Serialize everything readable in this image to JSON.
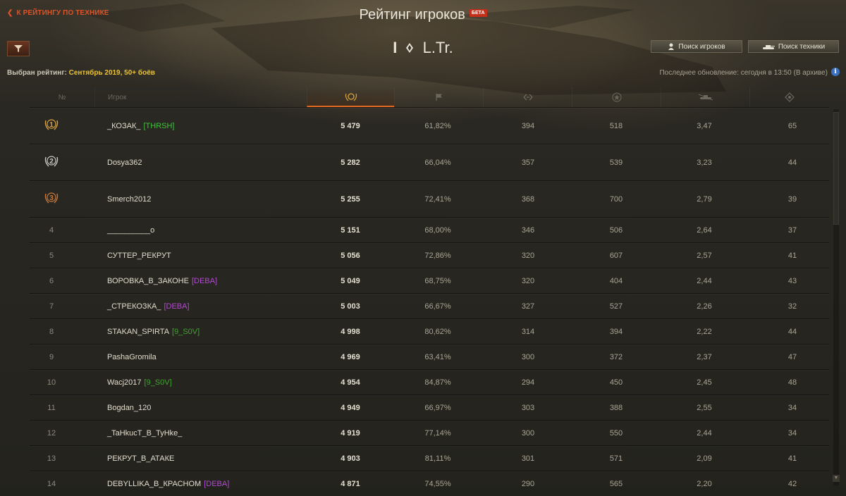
{
  "header": {
    "back_label": "К РЕЙТИНГУ ПО ТЕХНИКЕ",
    "title": "Рейтинг игроков",
    "beta": "БЕТА",
    "vehicle_tier": "I",
    "vehicle_name": "L.Tr.",
    "search_players_label": "Поиск игроков",
    "search_vehicles_label": "Поиск техники",
    "selected_rating_label": "Выбран рейтинг:",
    "selected_rating_value": "Сентябрь 2019, 50+ боёв",
    "last_update": "Последнее обновление: сегодня в 13:50 (В архиве)",
    "info_glyph": "i"
  },
  "table": {
    "col_rank": "№",
    "col_player": "Игрок",
    "rows": [
      {
        "rank": "1",
        "name": "_КОЗАК_",
        "clan": "[THRSH]",
        "clan_color": "#3fc43a",
        "rating": "5 479",
        "win": "61,82%",
        "dmg": "394",
        "exp": "518",
        "frags": "3,47",
        "spot": "65"
      },
      {
        "rank": "2",
        "name": "Dosya362",
        "clan": "",
        "clan_color": "",
        "rating": "5 282",
        "win": "66,04%",
        "dmg": "357",
        "exp": "539",
        "frags": "3,23",
        "spot": "44"
      },
      {
        "rank": "3",
        "name": "Smerch2012",
        "clan": "",
        "clan_color": "",
        "rating": "5 255",
        "win": "72,41%",
        "dmg": "368",
        "exp": "700",
        "frags": "2,79",
        "spot": "39"
      },
      {
        "rank": "4",
        "name": "__________o",
        "clan": "",
        "clan_color": "",
        "rating": "5 151",
        "win": "68,00%",
        "dmg": "346",
        "exp": "506",
        "frags": "2,64",
        "spot": "37"
      },
      {
        "rank": "5",
        "name": "СУТТЕР_РЕКРУТ",
        "clan": "",
        "clan_color": "",
        "rating": "5 056",
        "win": "72,86%",
        "dmg": "320",
        "exp": "607",
        "frags": "2,57",
        "spot": "41"
      },
      {
        "rank": "6",
        "name": "ВОРОВКА_В_ЗАКОНЕ",
        "clan": "[DEBA]",
        "clan_color": "#b14ad1",
        "rating": "5 049",
        "win": "68,75%",
        "dmg": "320",
        "exp": "404",
        "frags": "2,44",
        "spot": "43"
      },
      {
        "rank": "7",
        "name": "_СТРЕКОЗКА_",
        "clan": "[DEBA]",
        "clan_color": "#b14ad1",
        "rating": "5 003",
        "win": "66,67%",
        "dmg": "327",
        "exp": "527",
        "frags": "2,26",
        "spot": "32"
      },
      {
        "rank": "8",
        "name": "STAKAN_SPIRTA",
        "clan": "[9_S0V]",
        "clan_color": "#3ea52f",
        "rating": "4 998",
        "win": "80,62%",
        "dmg": "314",
        "exp": "394",
        "frags": "2,22",
        "spot": "44"
      },
      {
        "rank": "9",
        "name": "PashaGromila",
        "clan": "",
        "clan_color": "",
        "rating": "4 969",
        "win": "63,41%",
        "dmg": "300",
        "exp": "372",
        "frags": "2,37",
        "spot": "47"
      },
      {
        "rank": "10",
        "name": "Wacj2017",
        "clan": "[9_S0V]",
        "clan_color": "#3ea52f",
        "rating": "4 954",
        "win": "84,87%",
        "dmg": "294",
        "exp": "450",
        "frags": "2,45",
        "spot": "48"
      },
      {
        "rank": "11",
        "name": "Bogdan_120",
        "clan": "",
        "clan_color": "",
        "rating": "4 949",
        "win": "66,97%",
        "dmg": "303",
        "exp": "388",
        "frags": "2,55",
        "spot": "34"
      },
      {
        "rank": "12",
        "name": "_TaHkucT_B_TyHke_",
        "clan": "",
        "clan_color": "",
        "rating": "4 919",
        "win": "77,14%",
        "dmg": "300",
        "exp": "550",
        "frags": "2,44",
        "spot": "34"
      },
      {
        "rank": "13",
        "name": "РЕКРУТ_В_АТАКЕ",
        "clan": "",
        "clan_color": "",
        "rating": "4 903",
        "win": "81,11%",
        "dmg": "301",
        "exp": "571",
        "frags": "2,09",
        "spot": "41"
      },
      {
        "rank": "14",
        "name": "DEBYLLIKA_B_КРАСНОМ",
        "clan": "[DEBA]",
        "clan_color": "#b14ad1",
        "rating": "4 871",
        "win": "74,55%",
        "dmg": "290",
        "exp": "565",
        "frags": "2,20",
        "spot": "42"
      }
    ]
  },
  "colors": {
    "accent": "#d8542a",
    "highlight": "#e8c23a",
    "gold": "#d9a441",
    "silver": "#c9c9c9",
    "bronze": "#c77a3f"
  }
}
